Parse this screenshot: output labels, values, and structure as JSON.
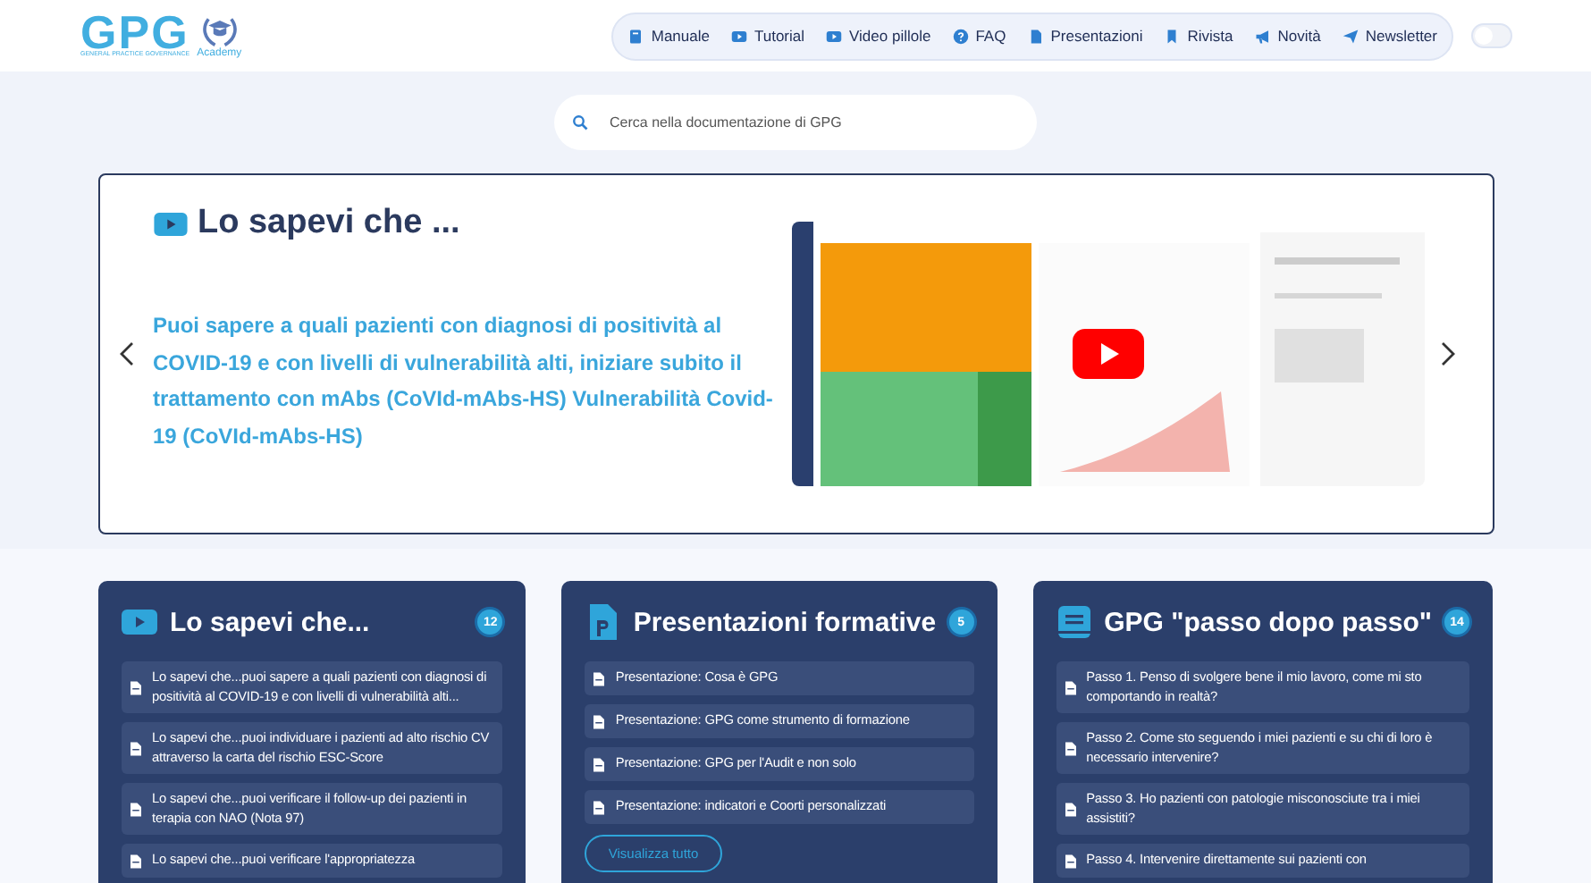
{
  "logo": {
    "mark": "GPG",
    "tagline": "GENERAL PRACTICE GOVERNANCE",
    "academy": "Academy"
  },
  "nav": [
    {
      "label": "Manuale"
    },
    {
      "label": "Tutorial"
    },
    {
      "label": "Video pillole"
    },
    {
      "label": "FAQ"
    },
    {
      "label": "Presentazioni"
    },
    {
      "label": "Rivista"
    },
    {
      "label": "Novità"
    },
    {
      "label": "Newsletter"
    }
  ],
  "dark_mode_toggle": {
    "on": false
  },
  "search": {
    "placeholder": "Cerca nella documentazione di GPG"
  },
  "carousel": {
    "title": "Lo sapevi che ...",
    "text": "Puoi sapere a quali pazienti con diagnosi di positività al COVID-19 e con livelli di vulnerabilità alti, iniziare subito il trattamento con mAbs (CoVId-mAbs-HS) Vulnerabilità Covid-19 (CoVId-mAbs-HS)"
  },
  "cards": [
    {
      "title": "Lo sapevi che...",
      "count": "12",
      "items": [
        "Lo sapevi che...puoi sapere a quali pazienti con diagnosi di positività al COVID-19 e con livelli di vulnerabilità alti...",
        "Lo sapevi che...puoi individuare i pazienti ad alto rischio CV attraverso la carta del rischio ESC-Score",
        "Lo sapevi che...puoi verificare il follow-up dei pazienti in terapia con NAO (Nota 97)",
        "Lo sapevi che...puoi verificare l'appropriatezza"
      ]
    },
    {
      "title": "Presentazioni formative",
      "count": "5",
      "items": [
        "Presentazione: Cosa è GPG",
        "Presentazione: GPG come strumento di formazione",
        "Presentazione: GPG per l'Audit e non solo",
        "Presentazione: indicatori e Coorti personalizzati"
      ],
      "button": "Visualizza tutto"
    },
    {
      "title": "GPG \"passo dopo passo\"",
      "count": "14",
      "items": [
        "Passo 1. Penso di svolgere bene il mio lavoro, come mi sto comportando in realtà?",
        "Passo 2. Come sto seguendo i miei pazienti e su chi di loro è necessario intervenire?",
        "Passo 3. Ho pazienti con patologie misconosciute tra i miei assistiti?",
        "Passo 4. Intervenire direttamente sui pazienti con"
      ]
    }
  ]
}
